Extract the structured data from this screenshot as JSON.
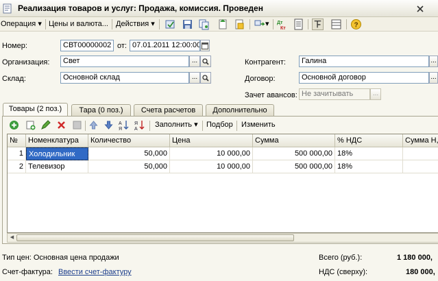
{
  "window": {
    "title": "Реализация товаров и услуг: Продажа, комиссия. Проведен"
  },
  "toolbar": {
    "operation": "Операция",
    "prices": "Цены и валюта...",
    "actions": "Действия",
    "dropdown_glyph": "▾"
  },
  "header": {
    "number_label": "Номер:",
    "number_value": "СВТ00000002",
    "from_label": "от:",
    "date_value": "07.01.2011 12:00:00",
    "org_label": "Организация:",
    "org_value": "Свет",
    "warehouse_label": "Склад:",
    "warehouse_value": "Основной склад",
    "counterparty_label": "Контрагент:",
    "counterparty_value": "Галина",
    "contract_label": "Договор:",
    "contract_value": "Основной договор",
    "advance_label": "Зачет авансов:",
    "advance_value": "Не зачитывать",
    "select_button": "...",
    "search_glyph": "🔍"
  },
  "tabs": [
    {
      "label": "Товары (2 поз.)"
    },
    {
      "label": "Тара (0 поз.)"
    },
    {
      "label": "Счета расчетов"
    },
    {
      "label": "Дополнительно"
    }
  ],
  "table_toolbar": {
    "fill": "Заполнить",
    "pick": "Подбор",
    "change": "Изменить"
  },
  "table": {
    "columns": [
      "№",
      "Номенклатура",
      "Количество",
      "Цена",
      "Сумма",
      "% НДС",
      "Сумма Н,"
    ],
    "rows": [
      {
        "n": "1",
        "item": "Холодильник",
        "qty": "50,000",
        "price": "10 000,00",
        "sum": "500 000,00",
        "vat": "18%"
      },
      {
        "n": "2",
        "item": "Телевизор",
        "qty": "50,000",
        "price": "10 000,00",
        "sum": "500 000,00",
        "vat": "18%"
      }
    ]
  },
  "footer": {
    "price_type": "Тип цен: Основная цена продажи",
    "invoice_label": "Счет-фактура:",
    "invoice_link": "Ввести счет-фактуру",
    "total_label": "Всего (руб.):",
    "total_value": "1 180 000,",
    "vat_label": "НДС (сверху):",
    "vat_value": "180 000,"
  },
  "colors": {
    "accent": "#316ac5",
    "link": "#1c3e8c",
    "background": "#f7f6ee"
  }
}
